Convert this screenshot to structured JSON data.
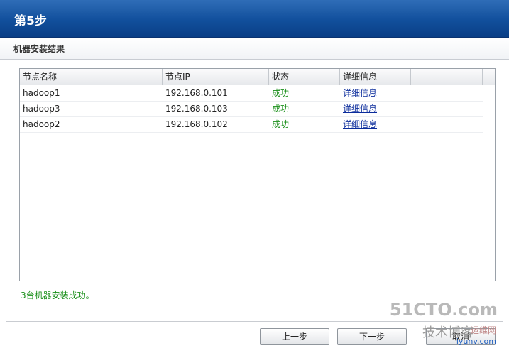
{
  "header": {
    "title": "第5步"
  },
  "subheader": {
    "label": "机器安装结果"
  },
  "table": {
    "columns": [
      "节点名称",
      "节点IP",
      "状态",
      "详细信息"
    ],
    "rows": [
      {
        "name": "hadoop1",
        "ip": "192.168.0.101",
        "status": "成功",
        "detail": "详细信息"
      },
      {
        "name": "hadoop3",
        "ip": "192.168.0.103",
        "status": "成功",
        "detail": "详细信息"
      },
      {
        "name": "hadoop2",
        "ip": "192.168.0.102",
        "status": "成功",
        "detail": "详细信息"
      }
    ]
  },
  "summary": "3台机器安装成功。",
  "buttons": {
    "prev": "上一步",
    "next": "下一步",
    "cancel": "取消"
  },
  "watermark": {
    "line1": "51CTO.com",
    "line2": "技术博客",
    "line3": "运维网",
    "line4": "iyunv.com"
  },
  "colors": {
    "header": "#114f9c",
    "success": "#1a8f1a",
    "link": "#0b2c9c"
  }
}
